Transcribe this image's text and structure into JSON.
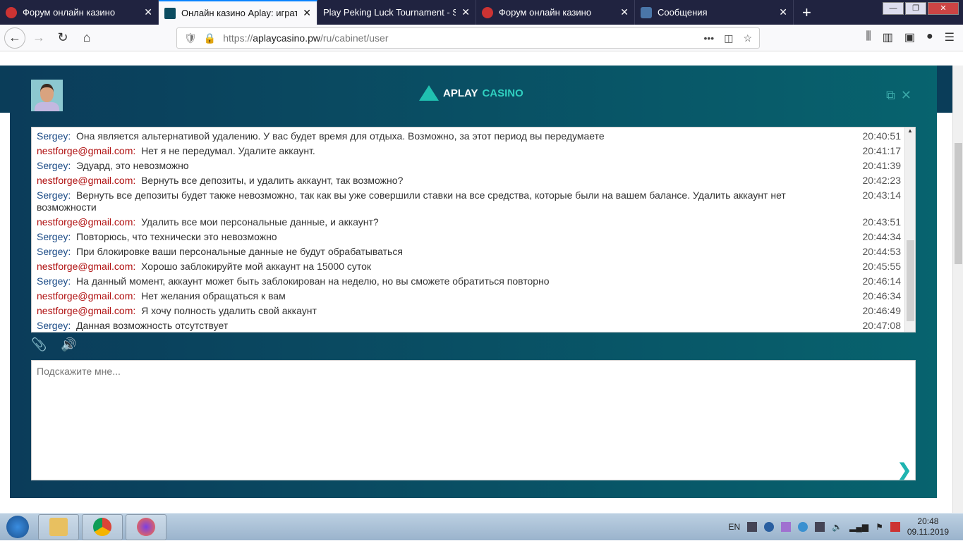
{
  "browser": {
    "tabs": [
      {
        "title": "Форум онлайн казино",
        "active": false
      },
      {
        "title": "Онлайн казино Aplay: играть",
        "active": true
      },
      {
        "title": "Play Peking Luck Tournament - Soc",
        "active": false
      },
      {
        "title": "Форум онлайн казино",
        "active": false
      },
      {
        "title": "Сообщения",
        "active": false
      }
    ],
    "close_glyph": "✕",
    "new_tab": "+",
    "url_scheme": "https://",
    "url_host": "aplaycasino.pw",
    "url_path": "/ru/cabinet/user"
  },
  "chat": {
    "logo_text": "APLAY",
    "logo_accent": "CASINO",
    "messages": [
      {
        "sender": "Sergey:",
        "type": "s",
        "text": "Она является альтернативой удалению. У вас будет время для отдыха. Возможно, за этот период вы передумаете",
        "time": "20:40:51"
      },
      {
        "sender": "nestforge@gmail.com:",
        "type": "u",
        "text": "Нет я не передумал. Удалите аккаунт.",
        "time": "20:41:17"
      },
      {
        "sender": "Sergey:",
        "type": "s",
        "text": "Эдуард, это невозможно",
        "time": "20:41:39"
      },
      {
        "sender": "nestforge@gmail.com:",
        "type": "u",
        "text": "Вернуть все депозиты, и удалить аккаунт, так возможно?",
        "time": "20:42:23"
      },
      {
        "sender": "Sergey:",
        "type": "s",
        "text": "Вернуть все депозиты будет также невозможно, так как вы уже совершили ставки на все средства, которые были на вашем балансе. Удалить аккаунт нет возможности",
        "time": "20:43:14"
      },
      {
        "sender": "nestforge@gmail.com:",
        "type": "u",
        "text": "Удалить все мои персональные данные, и аккаунт?",
        "time": "20:43:51"
      },
      {
        "sender": "Sergey:",
        "type": "s",
        "text": "Повторюсь, что технически это невозможно",
        "time": "20:44:34"
      },
      {
        "sender": "Sergey:",
        "type": "s",
        "text": "При блокировке ваши персональные данные не будут обрабатываться",
        "time": "20:44:53"
      },
      {
        "sender": "nestforge@gmail.com:",
        "type": "u",
        "text": "Хорошо заблокируйте мой аккаунт на 15000 суток",
        "time": "20:45:55"
      },
      {
        "sender": "Sergey:",
        "type": "s",
        "text": "На данный момент, аккаунт может быть заблокирован на неделю, но вы сможете обратиться повторно",
        "time": "20:46:14"
      },
      {
        "sender": "nestforge@gmail.com:",
        "type": "u",
        "text": "Нет желания обращаться к вам",
        "time": "20:46:34"
      },
      {
        "sender": "nestforge@gmail.com:",
        "type": "u",
        "text": "Я хочу полность удалить свой аккаунт",
        "time": "20:46:49"
      },
      {
        "sender": "Sergey:",
        "type": "s",
        "text": "Данная возможность отсутствует",
        "time": "20:47:08"
      }
    ],
    "input_placeholder": "Подскажите мне...",
    "send_glyph": "❯"
  },
  "taskbar": {
    "lang": "EN",
    "time": "20:48",
    "date": "09.11.2019"
  }
}
